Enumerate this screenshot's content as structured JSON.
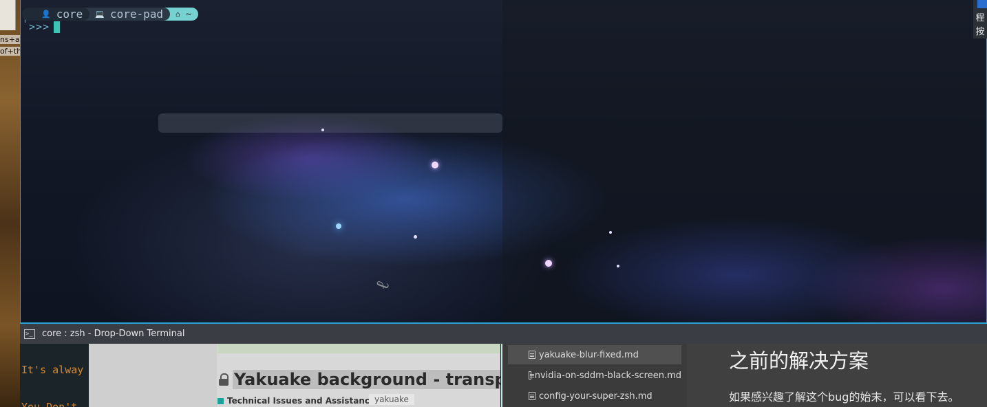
{
  "left_window": {
    "snippets": [
      "ns+a",
      "of+th"
    ]
  },
  "terminal": {
    "prompt": {
      "user": "core",
      "host": "core-pad",
      "dir": "~",
      "user_icon": "user-icon",
      "host_icon": "laptop-icon",
      "dir_icon": "home-icon",
      "second_line_arrows": ">>>"
    },
    "colors": {
      "border": "#2aa3d6",
      "dir_segment": "#75d2d0",
      "cursor": "#3cc4b4"
    }
  },
  "side_tab": {
    "chars": [
      "程",
      "按"
    ]
  },
  "titlebar": {
    "icon": "terminal-icon",
    "title": "core : zsh - Drop-Down Terminal"
  },
  "bottom_terminal": {
    "line1": "It's alway",
    "line2": "You Don't"
  },
  "forum": {
    "title": "Yakuake background - transpare",
    "category": "Technical Issues and Assistance",
    "tag": "yakuake"
  },
  "files": [
    {
      "name": "yakuake-blur-fixed.md",
      "selected": true
    },
    {
      "name": "nvidia-on-sddm-black-screen.md",
      "selected": false
    },
    {
      "name": "config-your-super-zsh.md",
      "selected": false
    }
  ],
  "article": {
    "heading": "之前的解决方案",
    "paragraph": "如果感兴趣了解这个bug的始末，可以看下去。"
  }
}
